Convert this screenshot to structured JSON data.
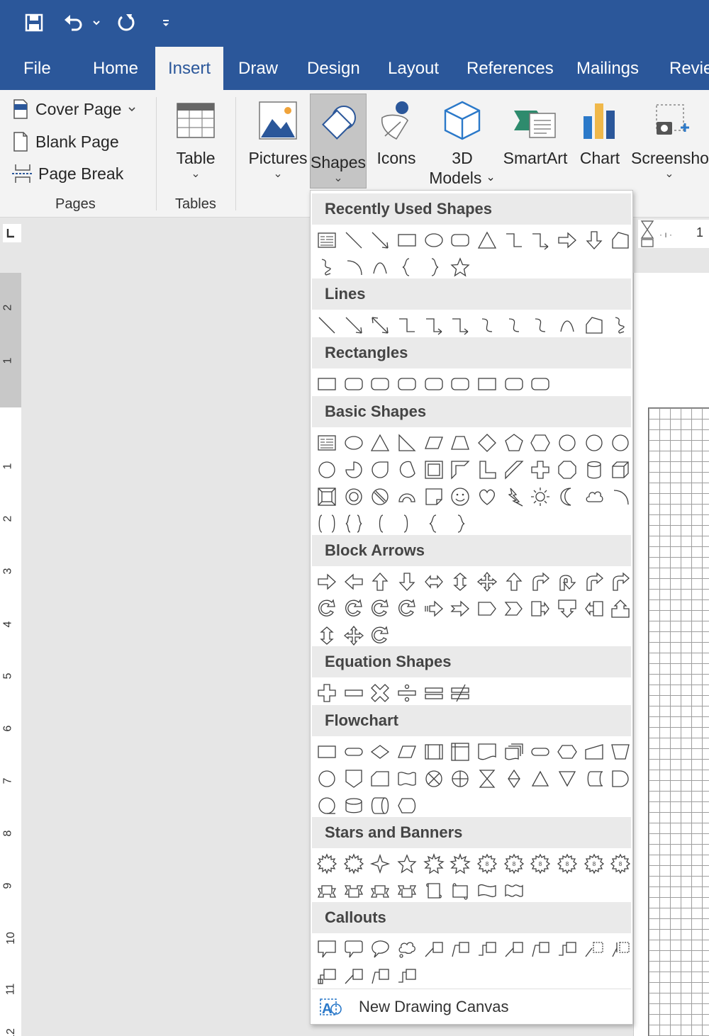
{
  "tabs": [
    {
      "id": "file",
      "label": "File",
      "active": false
    },
    {
      "id": "home",
      "label": "Home",
      "active": false
    },
    {
      "id": "insert",
      "label": "Insert",
      "active": true
    },
    {
      "id": "draw",
      "label": "Draw",
      "active": false
    },
    {
      "id": "design",
      "label": "Design",
      "active": false
    },
    {
      "id": "layout",
      "label": "Layout",
      "active": false
    },
    {
      "id": "references",
      "label": "References",
      "active": false
    },
    {
      "id": "mailings",
      "label": "Mailings",
      "active": false
    },
    {
      "id": "review",
      "label": "Revie",
      "active": false
    }
  ],
  "ribbon": {
    "pages": {
      "cover_page": "Cover Page",
      "blank_page": "Blank Page",
      "page_break": "Page Break",
      "group_label": "Pages"
    },
    "tables": {
      "table": "Table",
      "group_label": "Tables"
    },
    "pictures": "Pictures",
    "shapes": "Shapes",
    "icons": "Icons",
    "models_line1": "3D",
    "models_line2": "Models",
    "smartart": "SmartArt",
    "chart": "Chart",
    "screenshot": "Screenshot"
  },
  "ruler": {
    "horizontal_number": "1",
    "vertical_numbers": [
      "2",
      "1",
      "1",
      "2",
      "3",
      "4",
      "5",
      "6",
      "7",
      "8",
      "9",
      "10",
      "11",
      "12"
    ]
  },
  "dropdown": {
    "sections": [
      {
        "id": "recent",
        "title": "Recently Used Shapes",
        "counts": [
          12,
          6
        ]
      },
      {
        "id": "lines",
        "title": "Lines",
        "counts": [
          12
        ]
      },
      {
        "id": "rectangles",
        "title": "Rectangles",
        "counts": [
          9
        ]
      },
      {
        "id": "basic",
        "title": "Basic Shapes",
        "counts": [
          12,
          12,
          12,
          6
        ]
      },
      {
        "id": "arrows",
        "title": "Block Arrows",
        "counts": [
          12,
          12,
          3
        ]
      },
      {
        "id": "equation",
        "title": "Equation Shapes",
        "counts": [
          6
        ]
      },
      {
        "id": "flowchart",
        "title": "Flowchart",
        "counts": [
          12,
          12,
          4
        ]
      },
      {
        "id": "stars",
        "title": "Stars and Banners",
        "counts": [
          12,
          8
        ]
      },
      {
        "id": "callouts",
        "title": "Callouts",
        "counts": [
          12,
          4
        ]
      }
    ],
    "new_canvas": "New Drawing Canvas"
  },
  "colors": {
    "accent": "#2b579a",
    "ribbon_bg": "#f3f3f3",
    "shape_stroke": "#404040"
  }
}
